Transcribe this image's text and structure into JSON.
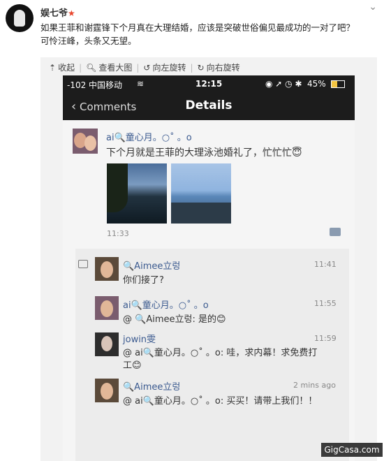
{
  "post": {
    "username": "娱七爷",
    "text_line1": "如果王菲和谢霆锋下个月真在大理结婚，应该是突破世俗偏见最成功的一对了吧？",
    "text_line2": "可怜汪峰，头条又无望。"
  },
  "toolbar": {
    "collapse": "收起",
    "view_large": "查看大图",
    "rotate_left": "向左旋转",
    "rotate_right": "向右旋转"
  },
  "phone": {
    "carrier": "-102 中国移动",
    "time": "12:15",
    "battery": "45%",
    "back_label": "Comments",
    "title": "Details"
  },
  "moment": {
    "author": "ai🔍童心月。○˚ 。o",
    "text": "下个月就是王菲的大理泳池婚礼了，忙忙忙😇",
    "time": "11:33"
  },
  "comments": [
    {
      "author": "🔍Aimee立렁",
      "time": "11:41",
      "text": "你们接了?"
    },
    {
      "author": "ai🔍童心月。○˚ 。o",
      "time": "11:55",
      "text": "@ 🔍Aimee立렁: 是的😊"
    },
    {
      "author": "jowin雯",
      "time": "11:59",
      "text_line1": "@ ai🔍童心月。○˚ 。o: 哇，求内幕！求免费打",
      "text_line2": "工😊"
    },
    {
      "author": "🔍Aimee立렁",
      "time": "2 mins ago",
      "text": "@ ai🔍童心月。○˚ 。o: 买买！请带上我们！！"
    }
  ],
  "watermark": "GigCasa.com",
  "colors": {
    "accent": "#e8452c",
    "nick": "#3b5a8f",
    "navbar": "#1c1c1c"
  }
}
